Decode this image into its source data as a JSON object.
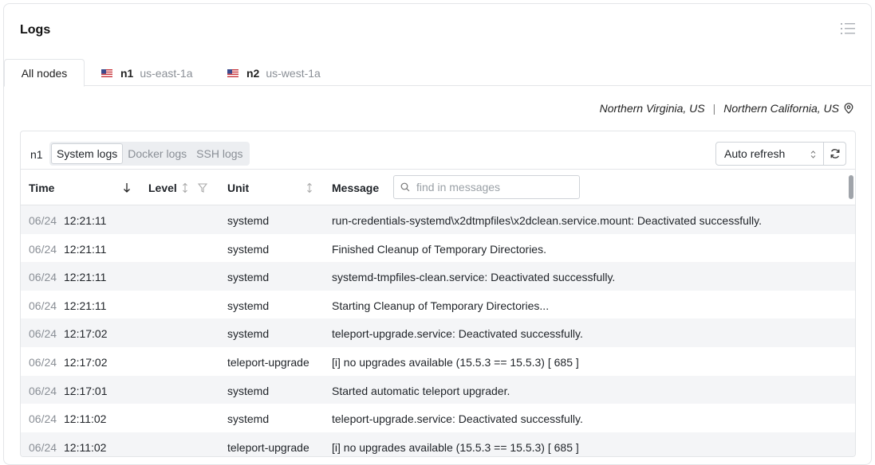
{
  "card": {
    "title": "Logs"
  },
  "tabs": [
    {
      "label": "All nodes"
    },
    {
      "node": "n1",
      "zone": "us-east-1a"
    },
    {
      "node": "n2",
      "zone": "us-west-1a"
    }
  ],
  "regions": {
    "first": "Northern Virginia, US",
    "separator": "|",
    "second": "Northern California, US"
  },
  "panel": {
    "node_label": "n1",
    "log_types": [
      "System logs",
      "Docker logs",
      "SSH logs"
    ],
    "selected_log_type": "System logs",
    "refresh_select": "Auto refresh"
  },
  "table": {
    "columns": {
      "time": "Time",
      "level": "Level",
      "unit": "Unit",
      "message": "Message"
    },
    "search_placeholder": "find in messages",
    "rows": [
      {
        "date": "06/24",
        "time": "12:21:11",
        "unit": "systemd",
        "message": "run-credentials-systemd\\x2dtmpfiles\\x2dclean.service.mount: Deactivated successfully."
      },
      {
        "date": "06/24",
        "time": "12:21:11",
        "unit": "systemd",
        "message": "Finished Cleanup of Temporary Directories."
      },
      {
        "date": "06/24",
        "time": "12:21:11",
        "unit": "systemd",
        "message": "systemd-tmpfiles-clean.service: Deactivated successfully."
      },
      {
        "date": "06/24",
        "time": "12:21:11",
        "unit": "systemd",
        "message": "Starting Cleanup of Temporary Directories..."
      },
      {
        "date": "06/24",
        "time": "12:17:02",
        "unit": "systemd",
        "message": "teleport-upgrade.service: Deactivated successfully."
      },
      {
        "date": "06/24",
        "time": "12:17:02",
        "unit": "teleport-upgrade",
        "message": "[i] no upgrades available (15.5.3 == 15.5.3) [ 685 ]"
      },
      {
        "date": "06/24",
        "time": "12:17:01",
        "unit": "systemd",
        "message": "Started automatic teleport upgrader."
      },
      {
        "date": "06/24",
        "time": "12:11:02",
        "unit": "systemd",
        "message": "teleport-upgrade.service: Deactivated successfully."
      },
      {
        "date": "06/24",
        "time": "12:11:02",
        "unit": "teleport-upgrade",
        "message": "[i] no upgrades available (15.5.3 == 15.5.3) [ 685 ]"
      }
    ]
  }
}
